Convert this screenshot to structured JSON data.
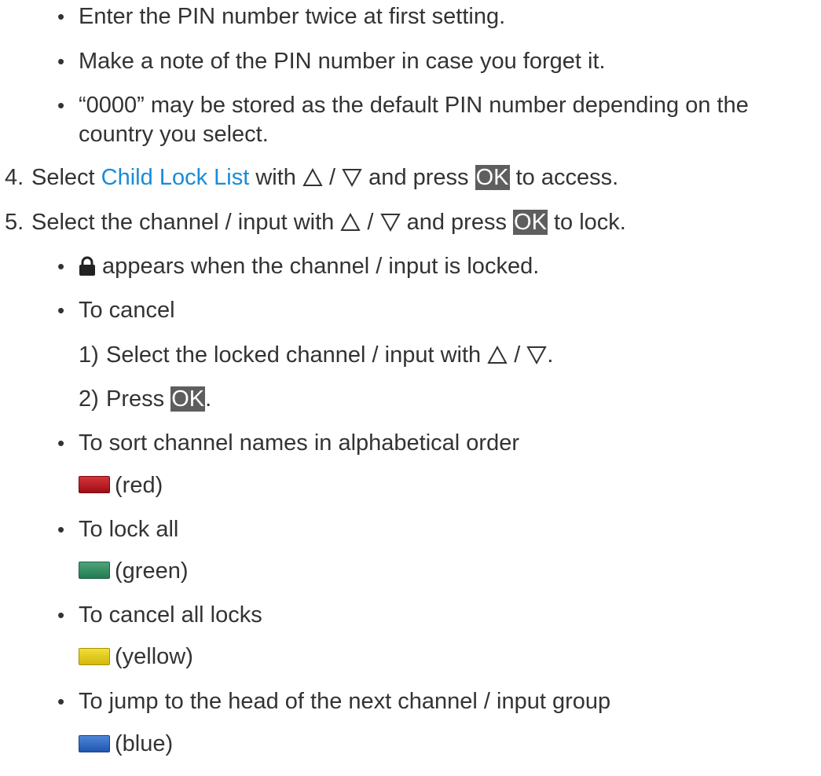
{
  "bullets_top": [
    "Enter the PIN number twice at first setting.",
    "Make a note of the PIN number in case you forget it.",
    "“0000” may be stored as the default PIN number depending on the",
    "country you select."
  ],
  "step4": {
    "number": "4.",
    "pre": "Select ",
    "link": "Child Lock List",
    "mid": " with ",
    "sep": " / ",
    "pre_ok": " and press ",
    "ok": "OK",
    "post": " to access."
  },
  "step5": {
    "number": "5.",
    "pre": "Select the channel / input with ",
    "sep": " / ",
    "pre_ok": " and press ",
    "ok": "OK",
    "post": " to lock."
  },
  "sub": {
    "locked_text": " appears when the channel / input is locked.",
    "to_cancel": "To cancel",
    "cancel_step1_num": "1)",
    "cancel_step1_text": "Select the locked channel / input with ",
    "cancel_step1_sep": " / ",
    "cancel_step1_end": ".",
    "cancel_step2_num": "2)",
    "cancel_step2_pre": "Press ",
    "cancel_step2_ok": "OK",
    "cancel_step2_end": ".",
    "sort": "To sort channel names in alphabetical order",
    "red_label": "(red)",
    "lock_all": "To lock all",
    "green_label": "(green)",
    "cancel_all": "To cancel all locks",
    "yellow_label": "(yellow)",
    "jump": "To jump to the head of the next channel / input group",
    "blue_label": "(blue)"
  },
  "bullet_char": "•",
  "icons": {
    "up": "triangle-up-outline-icon",
    "down": "triangle-down-outline-icon",
    "lock": "padlock-icon"
  },
  "colors": {
    "text": "#333333",
    "link": "#1a8bd6",
    "ok_bg": "#5e5e5e",
    "red": "#b51a20",
    "green": "#2e8b5e",
    "yellow": "#e6cc1a",
    "blue": "#2e68c4"
  }
}
